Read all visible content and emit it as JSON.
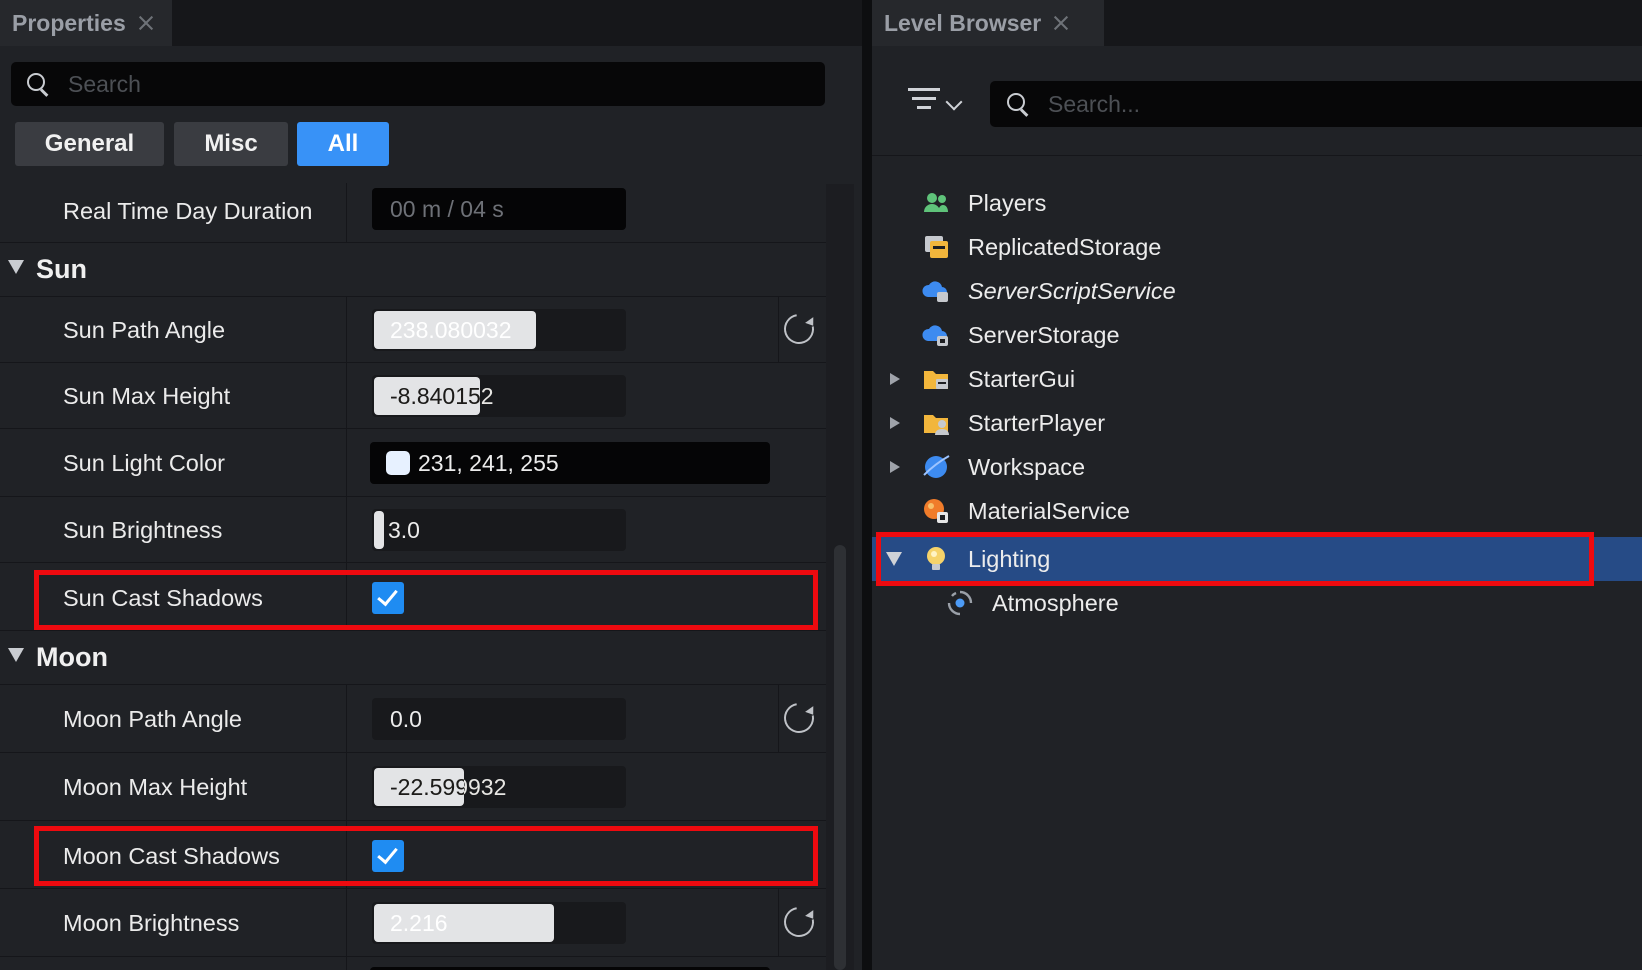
{
  "properties": {
    "tab_title": "Properties",
    "search_placeholder": "Search",
    "filters": [
      "General",
      "Misc",
      "All"
    ],
    "active_filter": "All",
    "rows": {
      "real_time": {
        "label": "Real Time Day Duration",
        "value": "00 m / 04 s"
      },
      "sun_path_angle": {
        "label": "Sun Path Angle",
        "value": "238.080032"
      },
      "sun_max_height": {
        "label": "Sun Max Height",
        "value": "-8.840152"
      },
      "sun_light_color": {
        "label": "Sun Light Color",
        "value": "231, 241, 255"
      },
      "sun_brightness": {
        "label": "Sun Brightness",
        "value": "3.0"
      },
      "sun_cast_shadows": {
        "label": "Sun Cast Shadows",
        "checked": true
      },
      "moon_path_angle": {
        "label": "Moon Path Angle",
        "value": "0.0"
      },
      "moon_max_height": {
        "label": "Moon Max Height",
        "value": "-22.599932"
      },
      "moon_cast_shadows": {
        "label": "Moon Cast Shadows",
        "checked": true
      },
      "moon_brightness": {
        "label": "Moon Brightness",
        "value": "2.216"
      }
    },
    "sections": {
      "sun": "Sun",
      "moon": "Moon"
    },
    "accent_color": "#3892f7",
    "highlight_color": "#ee0a0f",
    "sun_light_color_hex": "#e7f1ff"
  },
  "level_browser": {
    "tab_title": "Level Browser",
    "search_placeholder": "Search...",
    "items": [
      {
        "label": "Players",
        "icon": "players-icon"
      },
      {
        "label": "ReplicatedStorage",
        "icon": "replicated-storage-icon"
      },
      {
        "label": "ServerScriptService",
        "icon": "server-script-service-icon"
      },
      {
        "label": "ServerStorage",
        "icon": "server-storage-icon"
      },
      {
        "label": "StarterGui",
        "icon": "starter-gui-icon"
      },
      {
        "label": "StarterPlayer",
        "icon": "starter-player-icon"
      },
      {
        "label": "Workspace",
        "icon": "workspace-icon"
      },
      {
        "label": "MaterialService",
        "icon": "material-service-icon"
      },
      {
        "label": "Lighting",
        "icon": "lighting-bulb-icon"
      },
      {
        "label": "Atmosphere",
        "icon": "atmosphere-icon"
      }
    ],
    "selected_item": "Lighting",
    "selection_color": "#264b86"
  }
}
